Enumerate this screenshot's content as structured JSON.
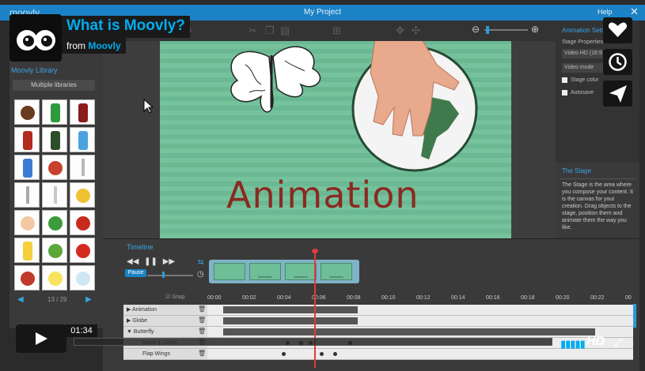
{
  "app": {
    "logo": "moovly",
    "window_title": "My Project",
    "help": "Help",
    "close": "✕"
  },
  "toolbar": {
    "zoom_out": "⊖",
    "zoom_in": "⊕",
    "zoom_level": 0.05
  },
  "library": {
    "title": "Moovly Library",
    "select_value": "Multiple libraries",
    "items": [
      "coffee-cup",
      "green-can",
      "soda-bottle",
      "ketchup-bottle",
      "wine-bottle",
      "water-bottle",
      "milk-carton",
      "tomato-soup",
      "spoon",
      "fork",
      "knife",
      "cheese",
      "egg",
      "lettuce",
      "tomato",
      "banana",
      "salad",
      "apple",
      "red-pepper",
      "light-bulb",
      "dove"
    ],
    "page": "13 / 29",
    "prev": "◀",
    "next": "▶"
  },
  "stage": {
    "caption": "Animation"
  },
  "animation_settings": {
    "header": "Animation Sett",
    "stage_properties": "Stage Properties",
    "video_format": "Video HD (16:9",
    "video_mode": "Video mode",
    "stage_color": "Stage color",
    "autosave": "Autosave"
  },
  "stage_info": {
    "title": "The Stage",
    "body": "The Stage is the area where you compose your content. It is the canvas for your creation. Drag objects to the stage, position them and animate them the way you like."
  },
  "timeline": {
    "title": "Timeline",
    "pause": "Pause",
    "snap": "Snap",
    "ticks": [
      "00:00",
      "00:02",
      "00:04",
      "00:06",
      "00:08",
      "00:10",
      "00:12",
      "00:14",
      "00:16",
      "00:18",
      "00:20",
      "00:22",
      "00"
    ],
    "scenes": [
      "",
      "Animation",
      "Animation",
      "Animation"
    ],
    "tracks": [
      {
        "label": "Animation",
        "arrow": "▶"
      },
      {
        "label": "Globe",
        "arrow": "▶"
      },
      {
        "label": "Butterfly",
        "arrow": "▼"
      },
      {
        "label": "Move & Zoom",
        "arrow": ""
      },
      {
        "label": "Flap Wings",
        "arrow": ""
      }
    ]
  },
  "player": {
    "video_title": "What is Moovly?",
    "from_prefix": "from",
    "from_name": "Moovly",
    "time": "01:34",
    "progress": 0.0,
    "hd": "HD",
    "side_buttons": [
      "heart-icon",
      "clock-icon",
      "send-icon"
    ]
  },
  "colors": {
    "accent": "#1b82c5",
    "vimeo_blue": "#00adef",
    "stage_green": "#6ebf97",
    "playhead": "#e23a3a"
  }
}
